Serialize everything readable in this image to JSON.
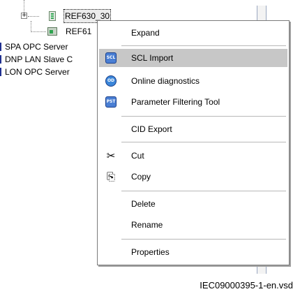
{
  "tree": {
    "nodes": [
      {
        "label": "REF630_30",
        "selected": true
      },
      {
        "label": "REF61"
      },
      {
        "label": "SPA OPC Server"
      },
      {
        "label": "DNP LAN Slave C"
      },
      {
        "label": "LON OPC Server"
      }
    ],
    "expander": "+"
  },
  "context_menu": {
    "items": [
      {
        "label": "Expand",
        "icon": ""
      },
      {
        "label": "SCL Import",
        "icon": "scl-import-icon",
        "badge": "SCL",
        "highlighted": true
      },
      {
        "label": "Online diagnostics",
        "icon": "online-diagnostics-icon",
        "badge": "OD"
      },
      {
        "label": "Parameter Filtering Tool",
        "icon": "parameter-filtering-icon",
        "badge": "PST"
      },
      {
        "label": "CID Export",
        "icon": ""
      },
      {
        "label": "Cut",
        "icon": "scissors-icon",
        "glyph": "✂"
      },
      {
        "label": "Copy",
        "icon": "copy-icon",
        "glyph": "⎘"
      },
      {
        "label": "Delete",
        "icon": ""
      },
      {
        "label": "Rename",
        "icon": ""
      },
      {
        "label": "Properties",
        "icon": ""
      }
    ]
  },
  "caption": "IEC09000395-1-en.vsd",
  "colors": {
    "highlight": "#c7c7c7",
    "badge_blue": "#4a7fd4",
    "bracket": "#1f2f8f"
  }
}
